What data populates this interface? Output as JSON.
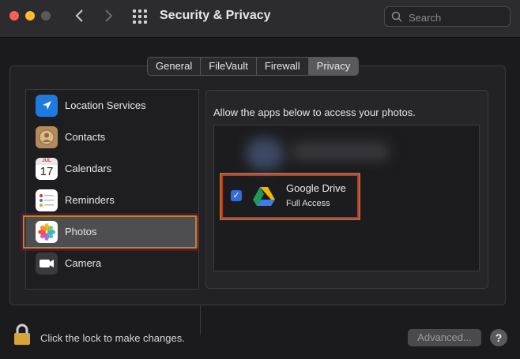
{
  "window": {
    "title": "Security & Privacy",
    "search_placeholder": "Search"
  },
  "tabs": [
    {
      "label": "General",
      "active": false
    },
    {
      "label": "FileVault",
      "active": false
    },
    {
      "label": "Firewall",
      "active": false
    },
    {
      "label": "Privacy",
      "active": true
    }
  ],
  "sidebar": {
    "items": [
      {
        "label": "Location Services",
        "icon": "location-arrow-icon",
        "selected": false
      },
      {
        "label": "Contacts",
        "icon": "contacts-icon",
        "selected": false
      },
      {
        "label": "Calendars",
        "icon": "calendar-icon",
        "selected": false
      },
      {
        "label": "Reminders",
        "icon": "reminders-icon",
        "selected": false
      },
      {
        "label": "Photos",
        "icon": "photos-icon",
        "selected": true
      },
      {
        "label": "Camera",
        "icon": "camera-icon",
        "selected": false
      }
    ],
    "calendar_month": "JUL",
    "calendar_day": "17"
  },
  "content": {
    "description": "Allow the apps below to access your photos.",
    "apps": [
      {
        "name": "Google Drive",
        "access": "Full Access",
        "checked": true,
        "icon": "google-drive-icon"
      }
    ]
  },
  "footer": {
    "lock_text": "Click the lock to make changes.",
    "advanced_label": "Advanced...",
    "help_label": "?"
  },
  "colors": {
    "accent": "#2f6fde",
    "highlight_red": "#d12f2f",
    "highlight_gold": "#b8862b"
  }
}
